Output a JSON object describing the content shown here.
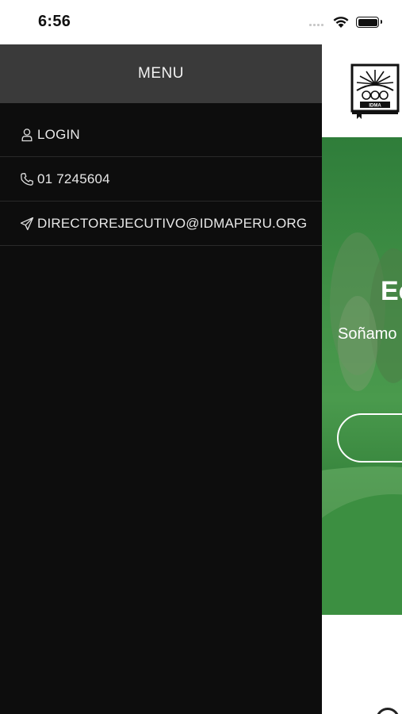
{
  "status_bar": {
    "time": "6:56"
  },
  "drawer": {
    "title": "MENU",
    "items": [
      {
        "label": "LOGIN",
        "icon": "user-icon"
      },
      {
        "label": "01 7245604",
        "icon": "phone-icon"
      },
      {
        "label": "DIRECTOREJECUTIVO@IDMAPERU.ORG",
        "icon": "send-icon"
      }
    ]
  },
  "page": {
    "logo_text": "IDMA",
    "hero_title": "Ec",
    "hero_subtitle": "Soñamo"
  },
  "colors": {
    "drawer_bg": "#0d0d0d",
    "drawer_header_bg": "#3a3a3a",
    "hero_green": "#2f7d3a",
    "text_light": "#e8e8e8"
  }
}
